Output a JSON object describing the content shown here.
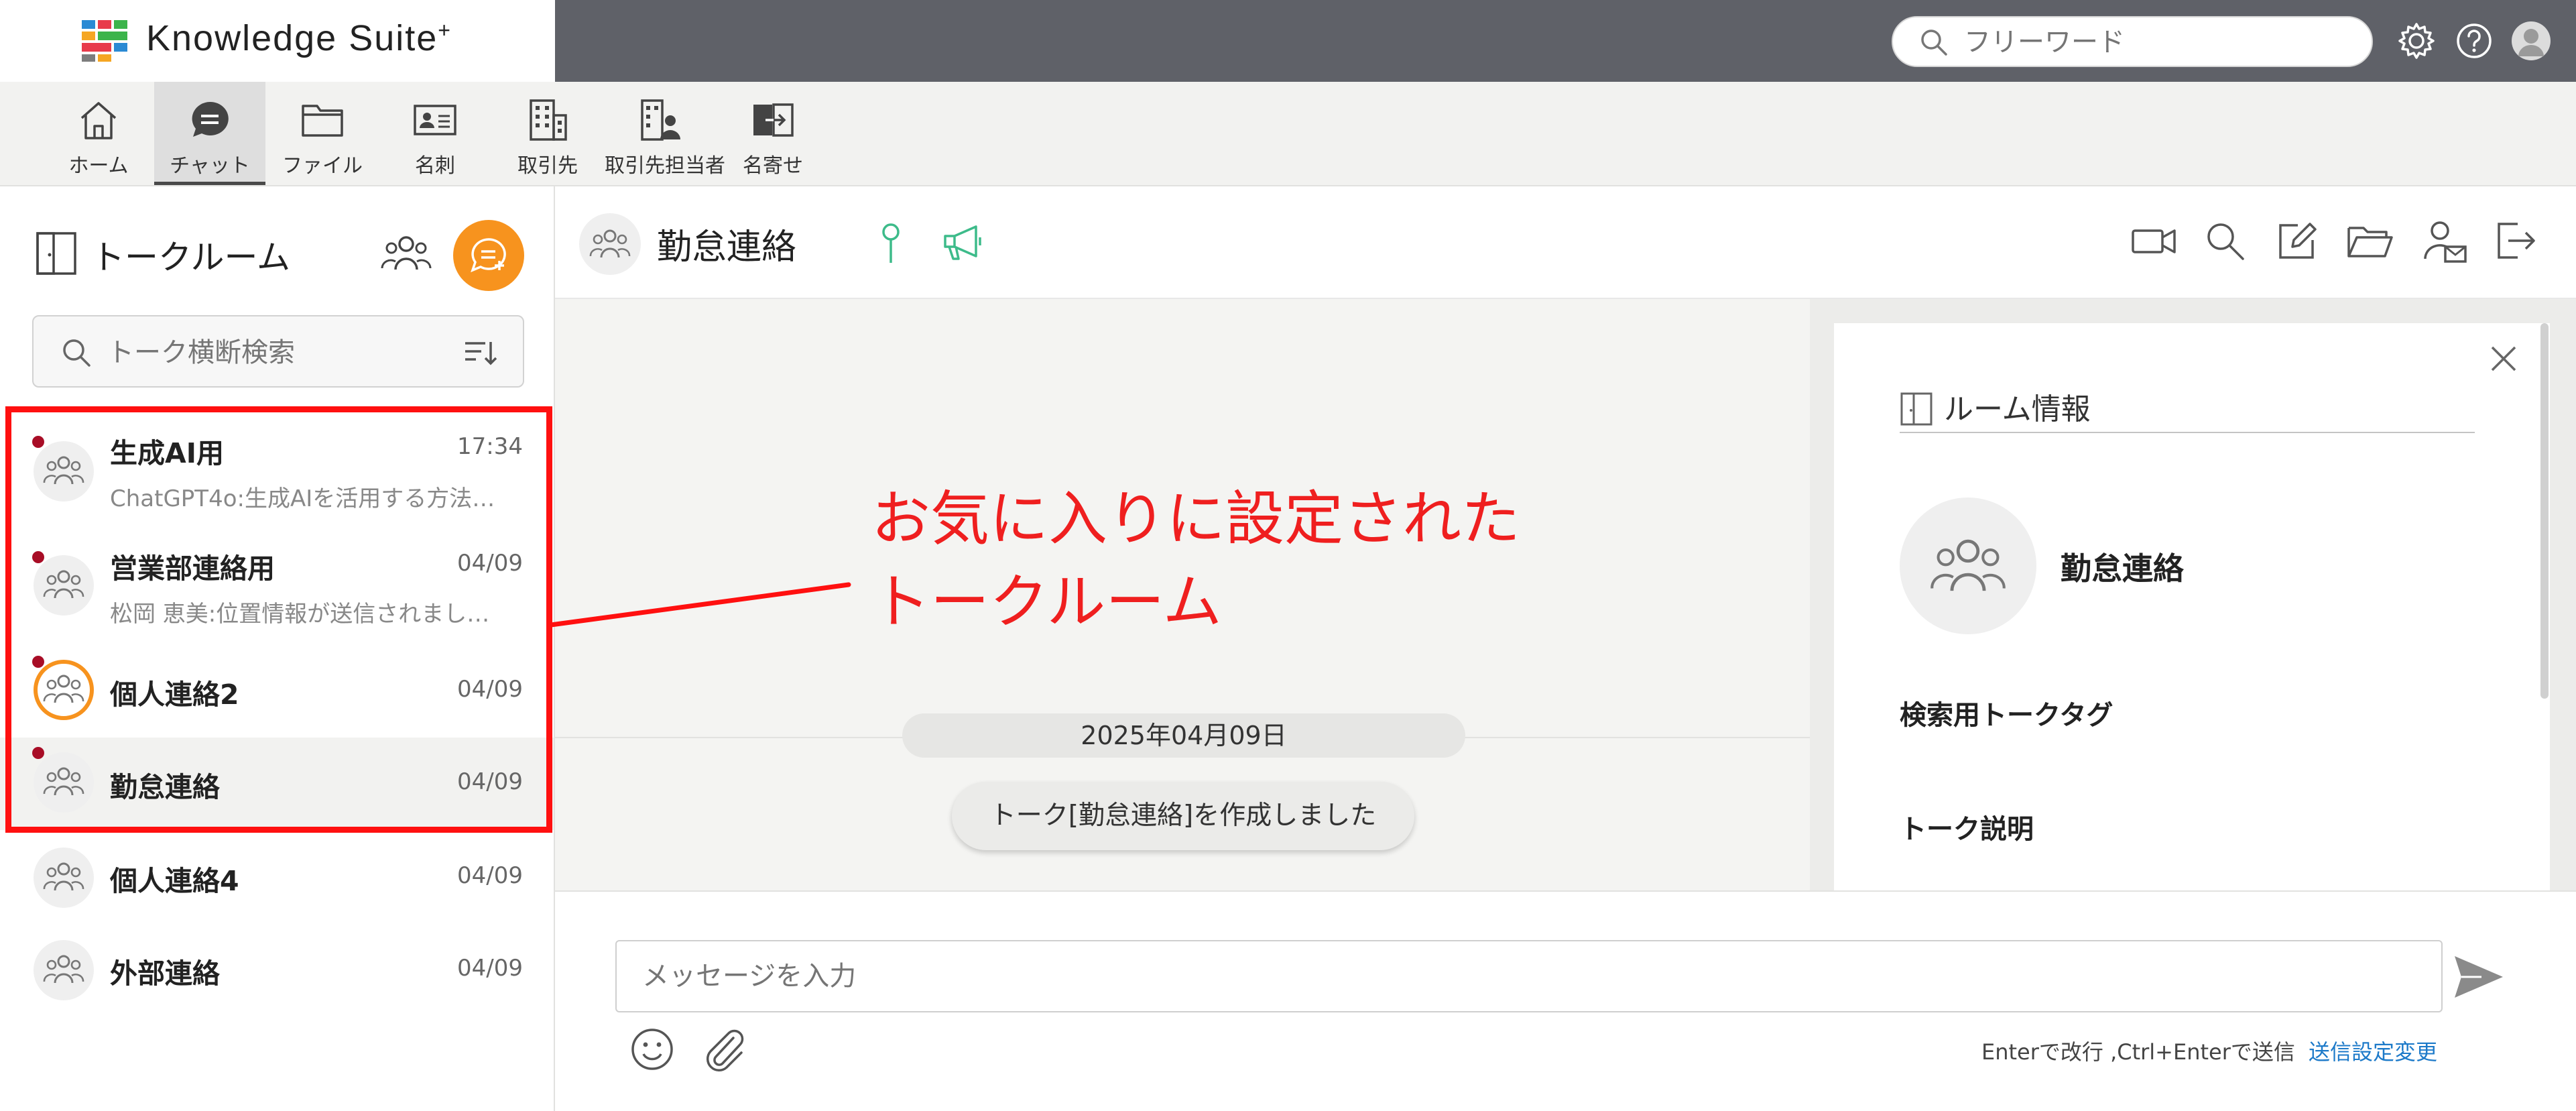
{
  "app": {
    "brand": "Knowledge Suite",
    "brand_suffix": "+",
    "search_placeholder": "フリーワード"
  },
  "nav": {
    "items": [
      {
        "label": "ホーム",
        "icon": "home-icon"
      },
      {
        "label": "チャット",
        "icon": "chat-icon",
        "active": true
      },
      {
        "label": "ファイル",
        "icon": "folder-icon"
      },
      {
        "label": "名刺",
        "icon": "business-card-icon"
      },
      {
        "label": "取引先",
        "icon": "building-icon"
      },
      {
        "label": "取引先担当者",
        "icon": "building-person-icon"
      },
      {
        "label": "名寄せ",
        "icon": "merge-icon"
      }
    ]
  },
  "sidebar": {
    "title": "トークルーム",
    "search_placeholder": "トーク横断検索",
    "rooms": [
      {
        "name": "生成AI用",
        "date": "17:34",
        "preview": "ChatGPT4o:生成AIを活用する方法…",
        "favorite": true
      },
      {
        "name": "営業部連絡用",
        "date": "04/09",
        "preview": "松岡 恵美:位置情報が送信されまし…",
        "favorite": true
      },
      {
        "name": "個人連絡2",
        "date": "04/09",
        "preview": "",
        "favorite": true
      },
      {
        "name": "勤怠連絡",
        "date": "04/09",
        "preview": "",
        "favorite": true,
        "selected": true
      },
      {
        "name": "個人連絡4",
        "date": "04/09",
        "preview": ""
      },
      {
        "name": "外部連絡",
        "date": "04/09",
        "preview": ""
      }
    ]
  },
  "annotation": {
    "line1": "お気に入りに設定された",
    "line2": "トークルーム",
    "color": "#ef1f1f"
  },
  "chat": {
    "title": "勤怠連絡",
    "date_divider": "2025年04月09日",
    "system_message": "トーク[勤怠連絡]を作成しました",
    "input_placeholder": "メッセージを入力",
    "send_hint": "Enterで改行 ,Ctrl+Enterで送信",
    "send_settings_link": "送信設定変更"
  },
  "room_info": {
    "title": "ルーム情報",
    "room_name": "勤怠連絡",
    "tag_label": "検索用トークタグ",
    "description_label": "トーク説明"
  },
  "colors": {
    "header_bg": "#5f6168",
    "accent_orange": "#f7931e",
    "favorite_dot": "#a80d26",
    "pin_green": "#3dbb8a",
    "link_blue": "#1d7ac9"
  }
}
